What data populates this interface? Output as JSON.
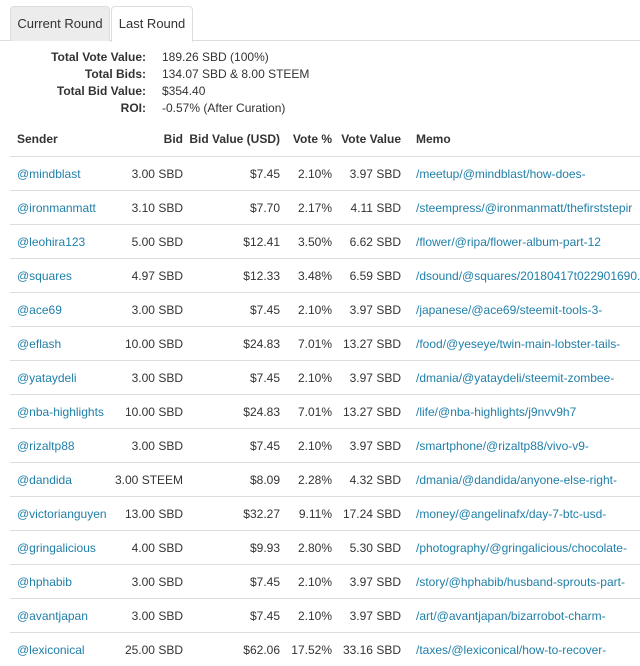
{
  "tabs": [
    {
      "label": "Current Round",
      "active": false
    },
    {
      "label": "Last Round",
      "active": true
    }
  ],
  "summary": [
    {
      "label": "Total Vote Value:",
      "value": "189.26 SBD (100%)"
    },
    {
      "label": "Total Bids:",
      "value": "134.07 SBD & 8.00 STEEM"
    },
    {
      "label": "Total Bid Value:",
      "value": "$354.40"
    },
    {
      "label": "ROI:",
      "value": "-0.57% (After Curation)"
    }
  ],
  "table": {
    "headers": {
      "sender": "Sender",
      "bid": "Bid",
      "bid_value": "Bid Value (USD)",
      "vote_pct": "Vote %",
      "vote_value": "Vote Value",
      "memo": "Memo"
    },
    "rows": [
      {
        "sender": "@mindblast",
        "bid": "3.00 SBD",
        "bid_value": "$7.45",
        "vote_pct": "2.10%",
        "vote_value": "3.97 SBD",
        "memo": "/meetup/@mindblast/how-does-"
      },
      {
        "sender": "@ironmanmatt",
        "bid": "3.10 SBD",
        "bid_value": "$7.70",
        "vote_pct": "2.17%",
        "vote_value": "4.11 SBD",
        "memo": "/steempress/@ironmanmatt/thefirststepir"
      },
      {
        "sender": "@leohira123",
        "bid": "5.00 SBD",
        "bid_value": "$12.41",
        "vote_pct": "3.50%",
        "vote_value": "6.62 SBD",
        "memo": "/flower/@ripa/flower-album-part-12"
      },
      {
        "sender": "@squares",
        "bid": "4.97 SBD",
        "bid_value": "$12.33",
        "vote_pct": "3.48%",
        "vote_value": "6.59 SBD",
        "memo": "/dsound/@squares/20180417t022901690."
      },
      {
        "sender": "@ace69",
        "bid": "3.00 SBD",
        "bid_value": "$7.45",
        "vote_pct": "2.10%",
        "vote_value": "3.97 SBD",
        "memo": "/japanese/@ace69/steemit-tools-3-"
      },
      {
        "sender": "@eflash",
        "bid": "10.00 SBD",
        "bid_value": "$24.83",
        "vote_pct": "7.01%",
        "vote_value": "13.27 SBD",
        "memo": "/food/@yeseye/twin-main-lobster-tails-"
      },
      {
        "sender": "@yataydeli",
        "bid": "3.00 SBD",
        "bid_value": "$7.45",
        "vote_pct": "2.10%",
        "vote_value": "3.97 SBD",
        "memo": "/dmania/@yataydeli/steemit-zombee-"
      },
      {
        "sender": "@nba-highlights",
        "bid": "10.00 SBD",
        "bid_value": "$24.83",
        "vote_pct": "7.01%",
        "vote_value": "13.27 SBD",
        "memo": "/life/@nba-highlights/j9nvv9h7"
      },
      {
        "sender": "@rizaltp88",
        "bid": "3.00 SBD",
        "bid_value": "$7.45",
        "vote_pct": "2.10%",
        "vote_value": "3.97 SBD",
        "memo": "/smartphone/@rizaltp88/vivo-v9-"
      },
      {
        "sender": "@dandida",
        "bid": "3.00 STEEM",
        "bid_value": "$8.09",
        "vote_pct": "2.28%",
        "vote_value": "4.32 SBD",
        "memo": "/dmania/@dandida/anyone-else-right-"
      },
      {
        "sender": "@victorianguyen",
        "bid": "13.00 SBD",
        "bid_value": "$32.27",
        "vote_pct": "9.11%",
        "vote_value": "17.24 SBD",
        "memo": "/money/@angelinafx/day-7-btc-usd-"
      },
      {
        "sender": "@gringalicious",
        "bid": "4.00 SBD",
        "bid_value": "$9.93",
        "vote_pct": "2.80%",
        "vote_value": "5.30 SBD",
        "memo": "/photography/@gringalicious/chocolate-"
      },
      {
        "sender": "@hphabib",
        "bid": "3.00 SBD",
        "bid_value": "$7.45",
        "vote_pct": "2.10%",
        "vote_value": "3.97 SBD",
        "memo": "/story/@hphabib/husband-sprouts-part-"
      },
      {
        "sender": "@avantjapan",
        "bid": "3.00 SBD",
        "bid_value": "$7.45",
        "vote_pct": "2.10%",
        "vote_value": "3.97 SBD",
        "memo": "/art/@avantjapan/bizarrobot-charm-"
      },
      {
        "sender": "@lexiconical",
        "bid": "25.00 SBD",
        "bid_value": "$62.06",
        "vote_pct": "17.52%",
        "vote_value": "33.16 SBD",
        "memo": "/taxes/@lexiconical/how-to-recover-"
      }
    ]
  },
  "colors": {
    "link": "#1f7fa8",
    "border": "#dddddd",
    "inactive_tab": "#ececec"
  }
}
